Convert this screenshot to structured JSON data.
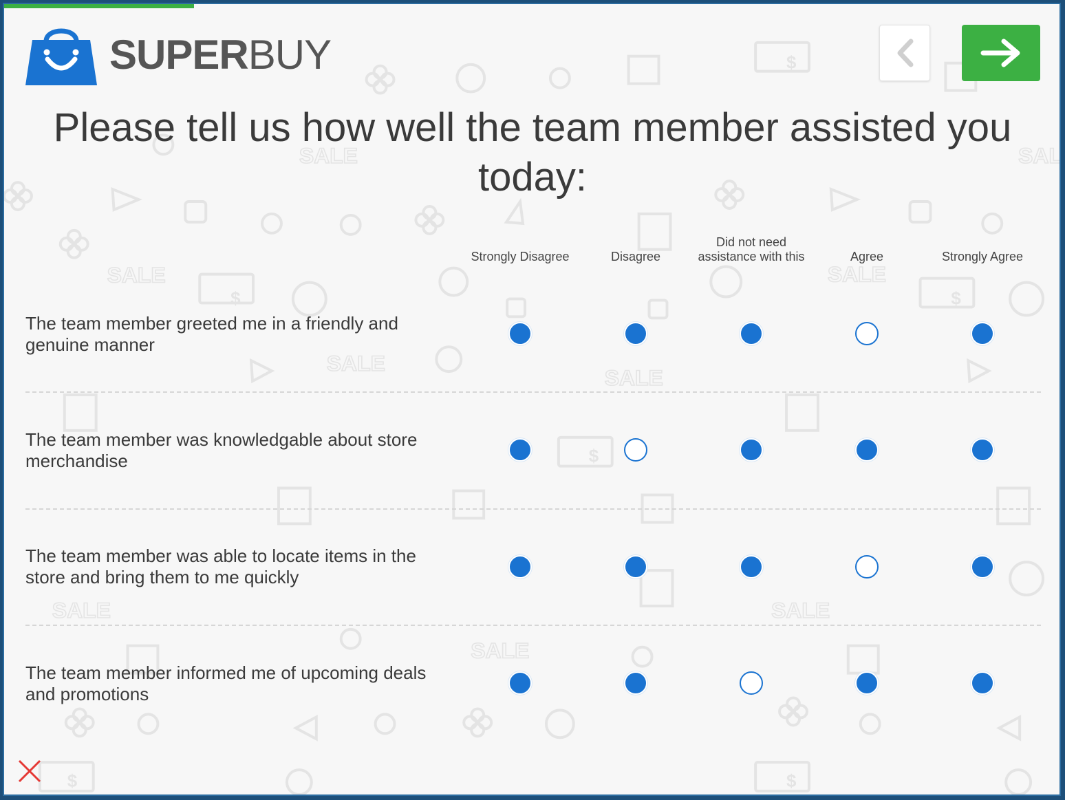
{
  "progress": {
    "fraction": 0.18,
    "color": "#3cb043"
  },
  "brand": {
    "name_bold": "SUPER",
    "name_light": "BUY",
    "logo_icon": "shopping-bag-smile-icon",
    "color": "#1a73d1"
  },
  "navigation": {
    "back_icon": "chevron-left-icon",
    "next_icon": "arrow-right-icon",
    "next_color": "#3cb043"
  },
  "question": {
    "title": "Please tell us how well the team member assisted you today:"
  },
  "scale": {
    "columns": [
      {
        "label": "Strongly Disagree"
      },
      {
        "label": "Disagree"
      },
      {
        "label": "Did not need assistance with this"
      },
      {
        "label": "Agree"
      },
      {
        "label": "Strongly Agree"
      }
    ]
  },
  "statements": [
    {
      "text": "The team member greeted me in a friendly and genuine manner",
      "options": [
        "filled",
        "filled",
        "filled",
        "empty",
        "filled"
      ]
    },
    {
      "text": "The team member was knowledgable about store merchandise",
      "options": [
        "filled",
        "empty",
        "filled",
        "filled",
        "filled"
      ]
    },
    {
      "text": "The team member was able to locate items in the store and bring them to me quickly",
      "options": [
        "filled",
        "filled",
        "filled",
        "empty",
        "filled"
      ]
    },
    {
      "text": "The team member informed me of upcoming deals and promotions",
      "options": [
        "filled",
        "filled",
        "empty",
        "filled",
        "filled"
      ]
    }
  ],
  "close": {
    "icon": "close-x-icon",
    "color": "#e53935"
  },
  "background": {
    "watermark_text": "SALE",
    "currency_symbol": "$"
  }
}
